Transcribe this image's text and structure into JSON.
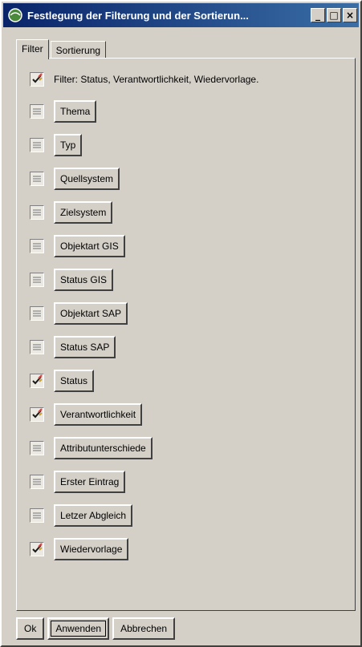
{
  "window": {
    "title": "Festlegung der Filterung und der Sortierun...",
    "minimize_glyph": "_",
    "maximize_glyph": "□",
    "close_glyph": "×"
  },
  "tabs": [
    {
      "label": "Filter",
      "active": true
    },
    {
      "label": "Sortierung",
      "active": false
    }
  ],
  "summary": {
    "checked": true,
    "text": "Filter: Status, Verantwortlichkeit, Wiedervorlage."
  },
  "filters": [
    {
      "label": "Thema",
      "checked": false
    },
    {
      "label": "Typ",
      "checked": false
    },
    {
      "label": "Quellsystem",
      "checked": false
    },
    {
      "label": "Zielsystem",
      "checked": false
    },
    {
      "label": "Objektart GIS",
      "checked": false
    },
    {
      "label": "Status GIS",
      "checked": false
    },
    {
      "label": "Objektart SAP",
      "checked": false
    },
    {
      "label": "Status SAP",
      "checked": false
    },
    {
      "label": "Status",
      "checked": true
    },
    {
      "label": "Verantwortlichkeit",
      "checked": true
    },
    {
      "label": "Attributunterschiede",
      "checked": false
    },
    {
      "label": "Erster Eintrag",
      "checked": false
    },
    {
      "label": "Letzer Abgleich",
      "checked": false
    },
    {
      "label": "Wiedervorlage",
      "checked": true
    }
  ],
  "buttons": {
    "ok": "Ok",
    "apply": "Anwenden",
    "cancel": "Abbrechen"
  },
  "colors": {
    "titlebar_start": "#0a246a",
    "titlebar_end": "#3a6ea5",
    "face": "#d4d0c8"
  }
}
